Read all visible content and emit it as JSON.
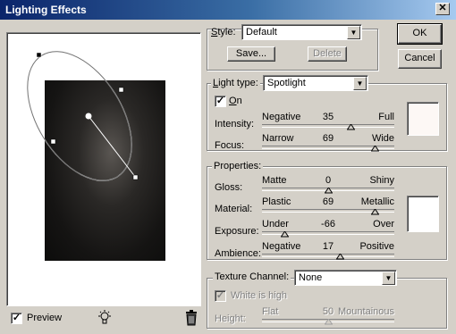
{
  "window": {
    "title": "Lighting Effects",
    "close_glyph": "✕"
  },
  "buttons": {
    "ok": "OK",
    "cancel": "Cancel",
    "save": "Save...",
    "delete": "Delete"
  },
  "style": {
    "label": "Style:",
    "value": "Default"
  },
  "light": {
    "type_label": "Light type:",
    "type_value": "Spotlight",
    "on_label": "On",
    "on_checked": true,
    "color": "#fdf8f5",
    "sliders": [
      {
        "label": "Intensity:",
        "min_label": "Negative",
        "value": "35",
        "max_label": "Full",
        "level": 0.67
      },
      {
        "label": "Focus:",
        "min_label": "Narrow",
        "value": "69",
        "max_label": "Wide",
        "level": 0.85
      }
    ]
  },
  "properties": {
    "title": "Properties:",
    "color": "#ffffff",
    "sliders": [
      {
        "label": "Gloss:",
        "min_label": "Matte",
        "value": "0",
        "max_label": "Shiny",
        "level": 0.5
      },
      {
        "label": "Material:",
        "min_label": "Plastic",
        "value": "69",
        "max_label": "Metallic",
        "level": 0.85
      },
      {
        "label": "Exposure:",
        "min_label": "Under",
        "value": "-66",
        "max_label": "Over",
        "level": 0.17
      },
      {
        "label": "Ambience:",
        "min_label": "Negative",
        "value": "17",
        "max_label": "Positive",
        "level": 0.585
      }
    ]
  },
  "texture": {
    "label": "Texture Channel:",
    "value": "None",
    "white_is_high_label": "White is high",
    "white_is_high_checked": true,
    "height": {
      "label": "Height:",
      "min_label": "Flat",
      "value": "50",
      "max_label": "Mountainous",
      "level": 0.5
    }
  },
  "preview": {
    "label": "Preview",
    "checked": true
  }
}
